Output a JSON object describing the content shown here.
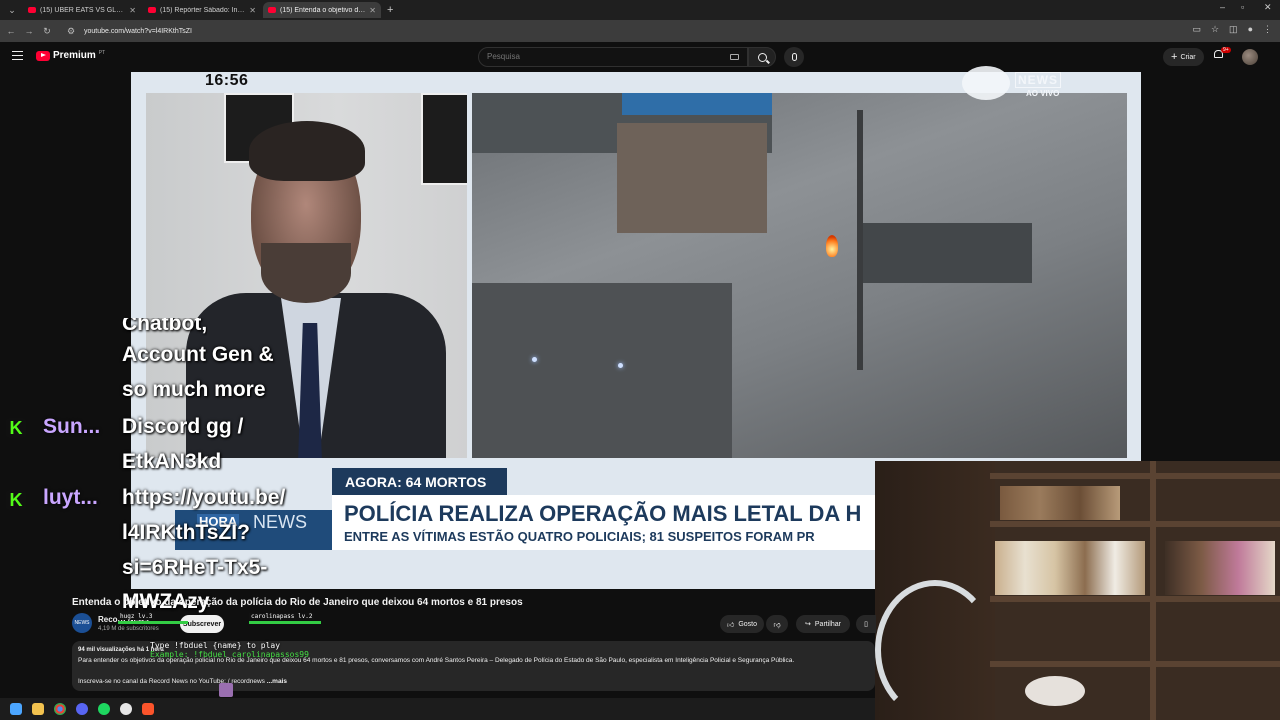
{
  "browser": {
    "tabs": [
      {
        "title": "(15) UBER EATS VS GLOVO I Cli",
        "active": false
      },
      {
        "title": "(15) Repórter Sábado: Influenc",
        "active": false
      },
      {
        "title": "(15) Entenda o objetivo da ope",
        "active": true
      }
    ],
    "url": "youtube.com/watch?v=l4IRKthTsZI"
  },
  "masthead": {
    "brand": "Premium",
    "region": "PT",
    "search_placeholder": "Pesquisa",
    "create_label": "Criar",
    "notifications_badge": "9+"
  },
  "video": {
    "clock": "16:56",
    "news_brand": "NEWS",
    "live_label": "AO VIVO",
    "tag": "AGORA: 64 MORTOS",
    "headline": "POLÍCIA REALIZA OPERAÇÃO MAIS LETAL DA H",
    "subline": "ENTRE AS VÍTIMAS ESTÃO QUATRO POLICIAIS; 81 SUSPEITOS FORAM PR",
    "program_logo_left": "HORA",
    "program_logo_right": "NEWS"
  },
  "overlay_chat": {
    "lines": [
      "Chatbot,",
      "Account Gen &",
      "so much more",
      "Discord gg /",
      "EtkAN3kd",
      "https://youtu.be/",
      "l4IRKthTsZI?",
      "si=6RHeT-Tx5-",
      "MWZAzy"
    ],
    "users": [
      "Sun...",
      "luyt..."
    ],
    "badge": "K"
  },
  "watch": {
    "title": "Entenda o objetivo da operação da polícia do Rio de Janeiro que deixou 64 mortos e 81 presos",
    "channel_name": "Record News",
    "channel_avatar_text": "NEWS",
    "subscribers": "4,19 M de subscritores",
    "subscribe_label": "Subscrever",
    "like_label": "Gosto",
    "share_label": "Partilhar",
    "views": "94 mil visualizações  há 1 hora",
    "description": "Para entender os objetivos da operação policial no Rio de Janeiro que deixou 64 mortos e 81 presos, conversamos com André Santos Pereira – Delegado de Polícia do Estado de São Paulo, especialista em Inteligência Policial e Segurança Pública.",
    "description_more_prefix": "Inscreva-se no canal da Record News no YouTube:",
    "description_more_link": "/ recordnews",
    "more_label": "...mais"
  },
  "game_overlay": {
    "player1": "hugz",
    "player1_level": "lv.3",
    "player2": "carolinapass",
    "player2_level": "lv.2",
    "instructions": "Type !fbduel {name} to play",
    "example": "Example: !fbduel carolinapassos99"
  },
  "colors": {
    "youtube_red": "#ff0033",
    "news_blue": "#1d3a5c",
    "kick_green": "#53fc18"
  }
}
